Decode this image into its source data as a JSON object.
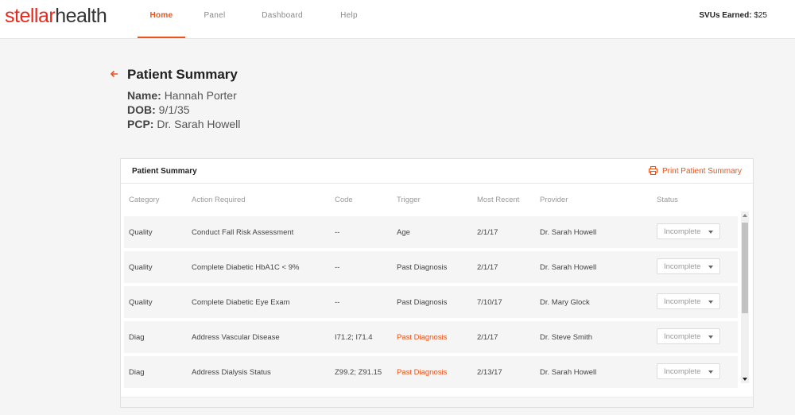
{
  "logo": {
    "part1": "stellar",
    "part2": "health"
  },
  "nav": [
    {
      "label": "Home",
      "active": true
    },
    {
      "label": "Panel",
      "active": false
    },
    {
      "label": "Dashboard",
      "active": false
    },
    {
      "label": "Help",
      "active": false
    }
  ],
  "svu": {
    "label": "SVUs Earned:",
    "value": "$25"
  },
  "header": {
    "title": "Patient Summary",
    "name_label": "Name:",
    "name": "Hannah Porter",
    "dob_label": "DOB:",
    "dob": "9/1/35",
    "pcp_label": "PCP:",
    "pcp": "Dr. Sarah Howell"
  },
  "card": {
    "title": "Patient Summary",
    "print_label": "Print Patient Summary",
    "columns": [
      "Category",
      "Action Required",
      "Code",
      "Trigger",
      "Most Recent",
      "Provider",
      "Status"
    ],
    "rows": [
      {
        "category": "Quality",
        "action": "Conduct Fall Risk Assessment",
        "code": "--",
        "trigger": "Age",
        "trigger_highlight": false,
        "recent": "2/1/17",
        "provider": "Dr. Sarah Howell",
        "status": "Incomplete"
      },
      {
        "category": "Quality",
        "action": "Complete Diabetic HbA1C < 9%",
        "code": "--",
        "trigger": "Past Diagnosis",
        "trigger_highlight": false,
        "recent": "2/1/17",
        "provider": "Dr. Sarah Howell",
        "status": "Incomplete"
      },
      {
        "category": "Quality",
        "action": "Complete Diabetic Eye Exam",
        "code": "--",
        "trigger": "Past Diagnosis",
        "trigger_highlight": false,
        "recent": "7/10/17",
        "provider": "Dr. Mary Glock",
        "status": "Incomplete"
      },
      {
        "category": "Diag",
        "action": "Address Vascular Disease",
        "code": "I71.2; I71.4",
        "trigger": "Past Diagnosis",
        "trigger_highlight": true,
        "recent": "2/1/17",
        "provider": "Dr. Steve Smith",
        "status": "Incomplete"
      },
      {
        "category": "Diag",
        "action": "Address Dialysis Status",
        "code": "Z99.2; Z91.15",
        "trigger": "Past Diagnosis",
        "trigger_highlight": true,
        "recent": "2/13/17",
        "provider": "Dr. Sarah Howell",
        "status": "Incomplete"
      }
    ]
  },
  "colors": {
    "accent": "#e8541c",
    "brand_red": "#e8281a"
  }
}
